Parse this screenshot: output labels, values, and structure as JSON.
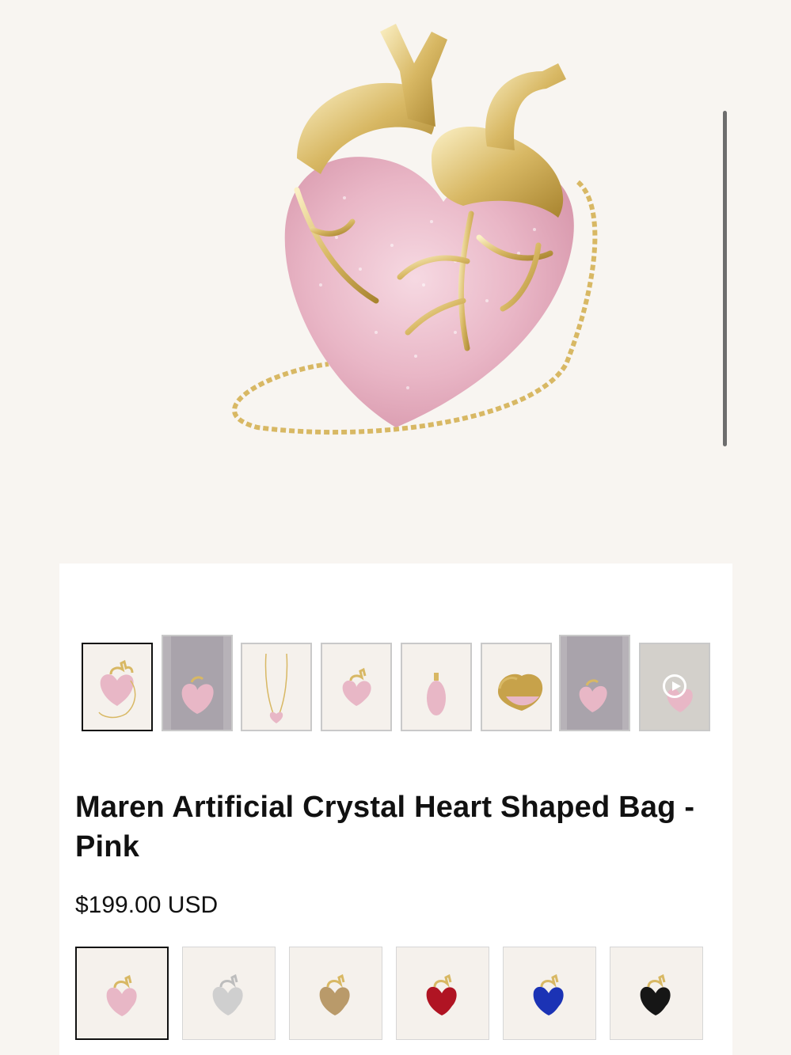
{
  "product": {
    "title": "Maren Artificial Crystal Heart Shaped Bag - Pink",
    "price": "$199.00 USD"
  },
  "gallery": {
    "main_image": "heart-bag-pink",
    "thumbnails": [
      "heart-bag-front",
      "model-dress",
      "bag-full-chain",
      "heart-front-small",
      "heart-side",
      "heart-open-interior",
      "model-dress-2",
      "video"
    ],
    "selected_index": 0
  },
  "colors": {
    "options": [
      {
        "name": "pink",
        "hex": "#e8b7c6"
      },
      {
        "name": "silver",
        "hex": "#c9c9c9"
      },
      {
        "name": "gold",
        "hex": "#b99a6a"
      },
      {
        "name": "red",
        "hex": "#b01423"
      },
      {
        "name": "blue",
        "hex": "#1b33b5"
      },
      {
        "name": "black",
        "hex": "#161616"
      }
    ],
    "selected_index": 0,
    "accent_gold": "#d8b864"
  }
}
